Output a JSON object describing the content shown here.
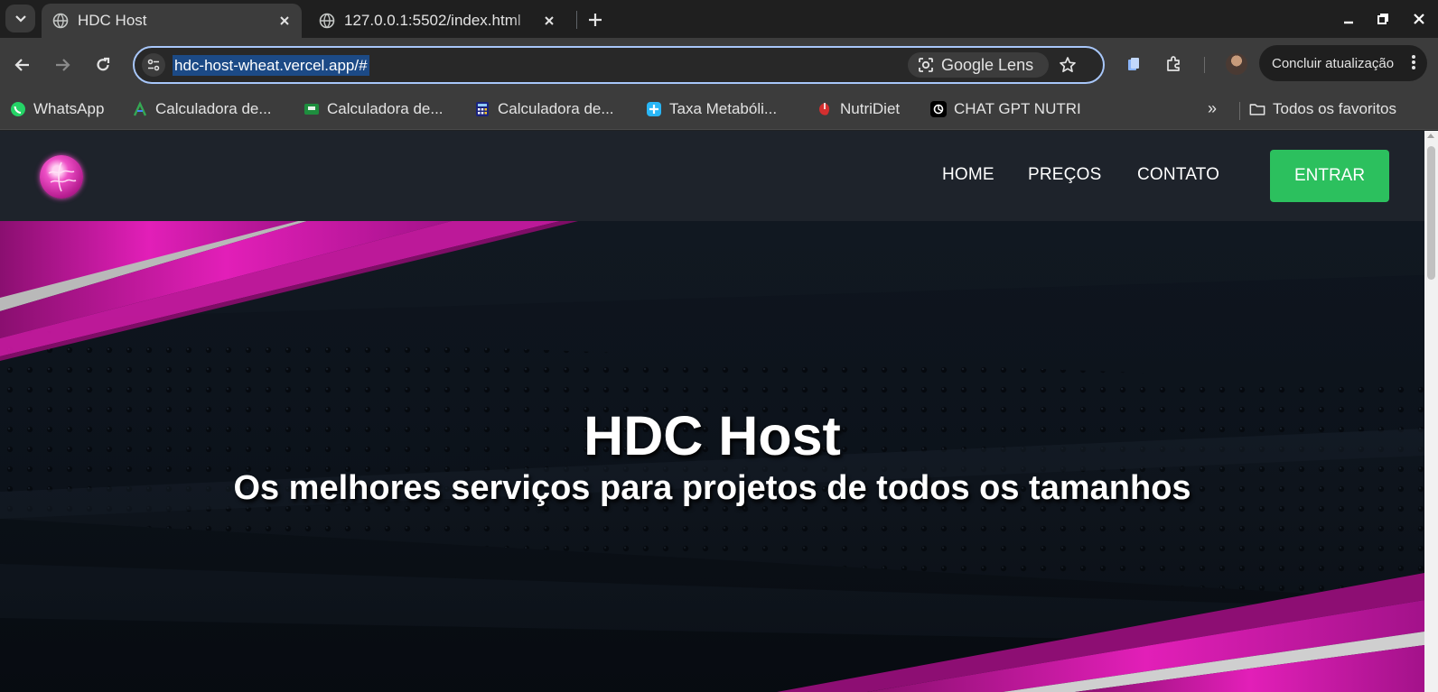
{
  "browser": {
    "tabs": [
      {
        "title": "HDC Host",
        "active": true
      },
      {
        "title": "127.0.0.1:5502/index.html",
        "active": false
      }
    ],
    "url": "hdc-host-wheat.vercel.app/#",
    "lens_label": "Google Lens",
    "update_label": "Concluir atualização",
    "bookmarks": [
      {
        "label": "WhatsApp",
        "icon": "whatsapp-icon"
      },
      {
        "label": "Calculadora de...",
        "icon": "calculator-green-icon"
      },
      {
        "label": "Calculadora de...",
        "icon": "calculator-sheet-icon"
      },
      {
        "label": "Calculadora de...",
        "icon": "calculator-grid-icon"
      },
      {
        "label": "Taxa Metabóli...",
        "icon": "metabolic-icon"
      },
      {
        "label": "NutriDiet",
        "icon": "nutridiet-icon"
      },
      {
        "label": "CHAT GPT NUTRI",
        "icon": "openai-icon"
      }
    ],
    "more_bookmarks": "»",
    "all_bookmarks_label": "Todos os favoritos"
  },
  "site": {
    "nav": {
      "links": [
        "HOME",
        "PREÇOS",
        "CONTATO"
      ],
      "cta": "ENTRAR"
    },
    "hero": {
      "title": "HDC Host",
      "subtitle": "Os melhores serviços para projetos de todos os tamanhos"
    }
  },
  "colors": {
    "cta_green": "#2cc05e",
    "nav_bg": "#1e232b",
    "accent_magenta": "#d81fb0"
  }
}
